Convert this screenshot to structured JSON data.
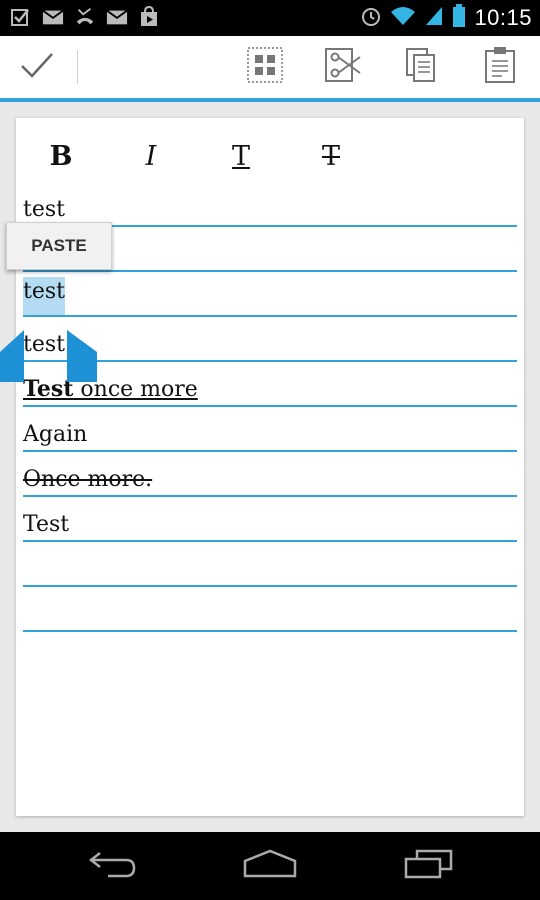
{
  "status_bar": {
    "time": "10:15",
    "left_icons": [
      "checkbox-icon",
      "gmail-icon",
      "missed-call-icon",
      "email-icon",
      "play-store-icon"
    ],
    "right_icons": [
      "alarm-icon",
      "wifi-icon",
      "signal-icon",
      "battery-icon"
    ]
  },
  "toolbar": {
    "done_icon": "checkmark-icon",
    "actions": [
      "select-all-icon",
      "cut-icon",
      "copy-icon",
      "paste-icon"
    ]
  },
  "format_bar": {
    "bold": "B",
    "italic": "I",
    "underline": "T",
    "strike": "T"
  },
  "editor": {
    "lines": [
      {
        "text": "test"
      },
      {
        "text": ""
      },
      {
        "text": "test",
        "selected": true
      },
      {
        "text": "test"
      },
      {
        "bold_part": "Test",
        "rest": " once more",
        "underline": true
      },
      {
        "text": "Again"
      },
      {
        "text": "Once more.",
        "strike": true
      },
      {
        "text": "Test"
      },
      {
        "text": ""
      },
      {
        "text": ""
      }
    ]
  },
  "paste_popup": {
    "label": "PASTE"
  },
  "colors": {
    "accent": "#33a1db",
    "selection": "#b3dcf2",
    "handle": "#1e90d6"
  },
  "nav_bar": [
    "back-icon",
    "home-icon",
    "recent-apps-icon"
  ]
}
